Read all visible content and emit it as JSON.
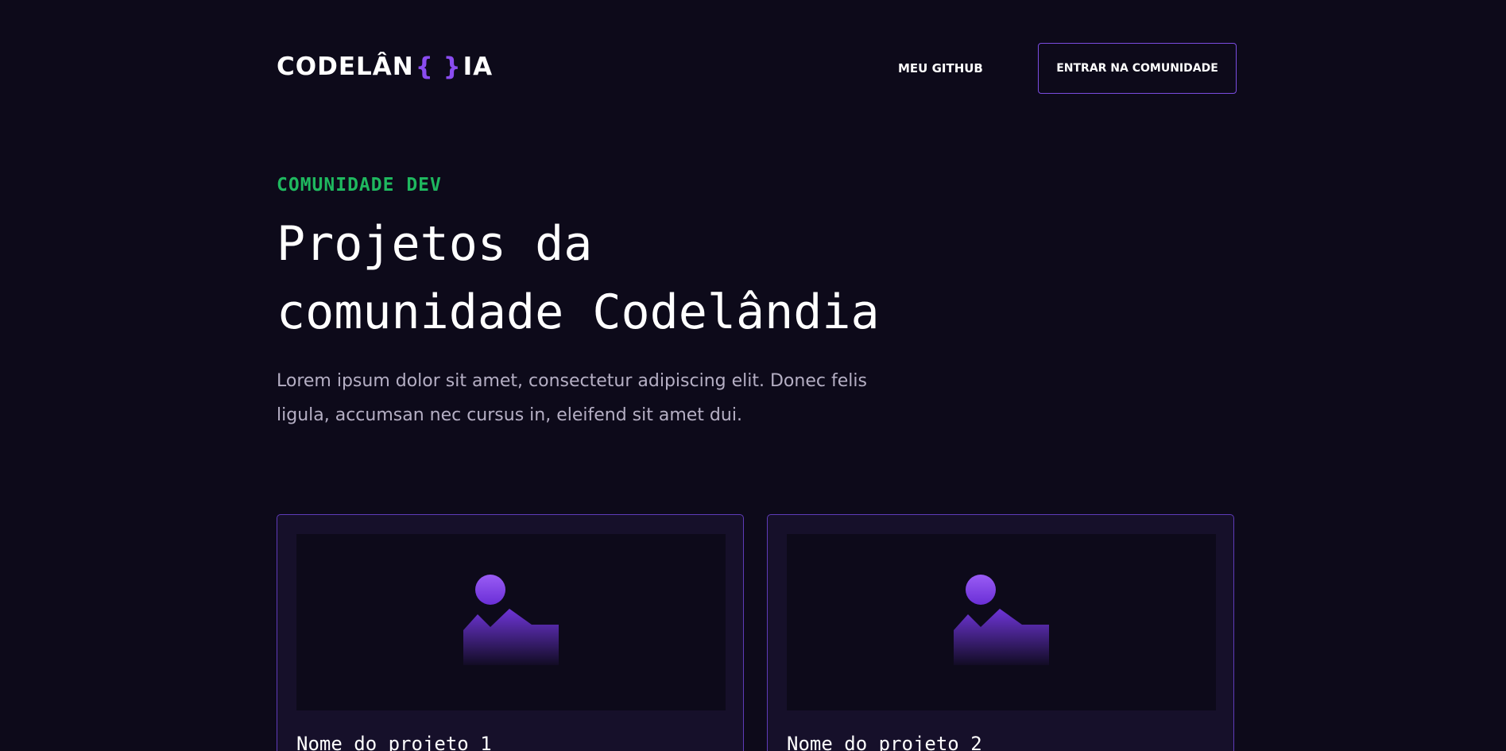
{
  "header": {
    "logo_before": "CODELÂN",
    "logo_brace": "{ }",
    "logo_after": "IA",
    "nav_github": "MEU GITHUB",
    "cta_label": "ENTRAR NA COMUNIDADE"
  },
  "hero": {
    "eyebrow": "COMUNIDADE DEV",
    "title_line1": "Projetos da",
    "title_line2": "comunidade Codelândia",
    "description": "Lorem ipsum dolor sit amet, consectetur adipiscing elit. Donec felis ligula, accumsan nec cursus in, eleifend sit amet dui."
  },
  "projects": [
    {
      "name": "Nome do projeto 1",
      "thumbnail_icon": "image-placeholder-icon"
    },
    {
      "name": "Nome do projeto 2",
      "thumbnail_icon": "image-placeholder-icon"
    }
  ],
  "colors": {
    "background": "#0d0a1a",
    "accent_purple": "#8a4cf0",
    "accent_green": "#1fb85f",
    "card_background": "#16102a",
    "text_muted": "#b5afc4"
  }
}
